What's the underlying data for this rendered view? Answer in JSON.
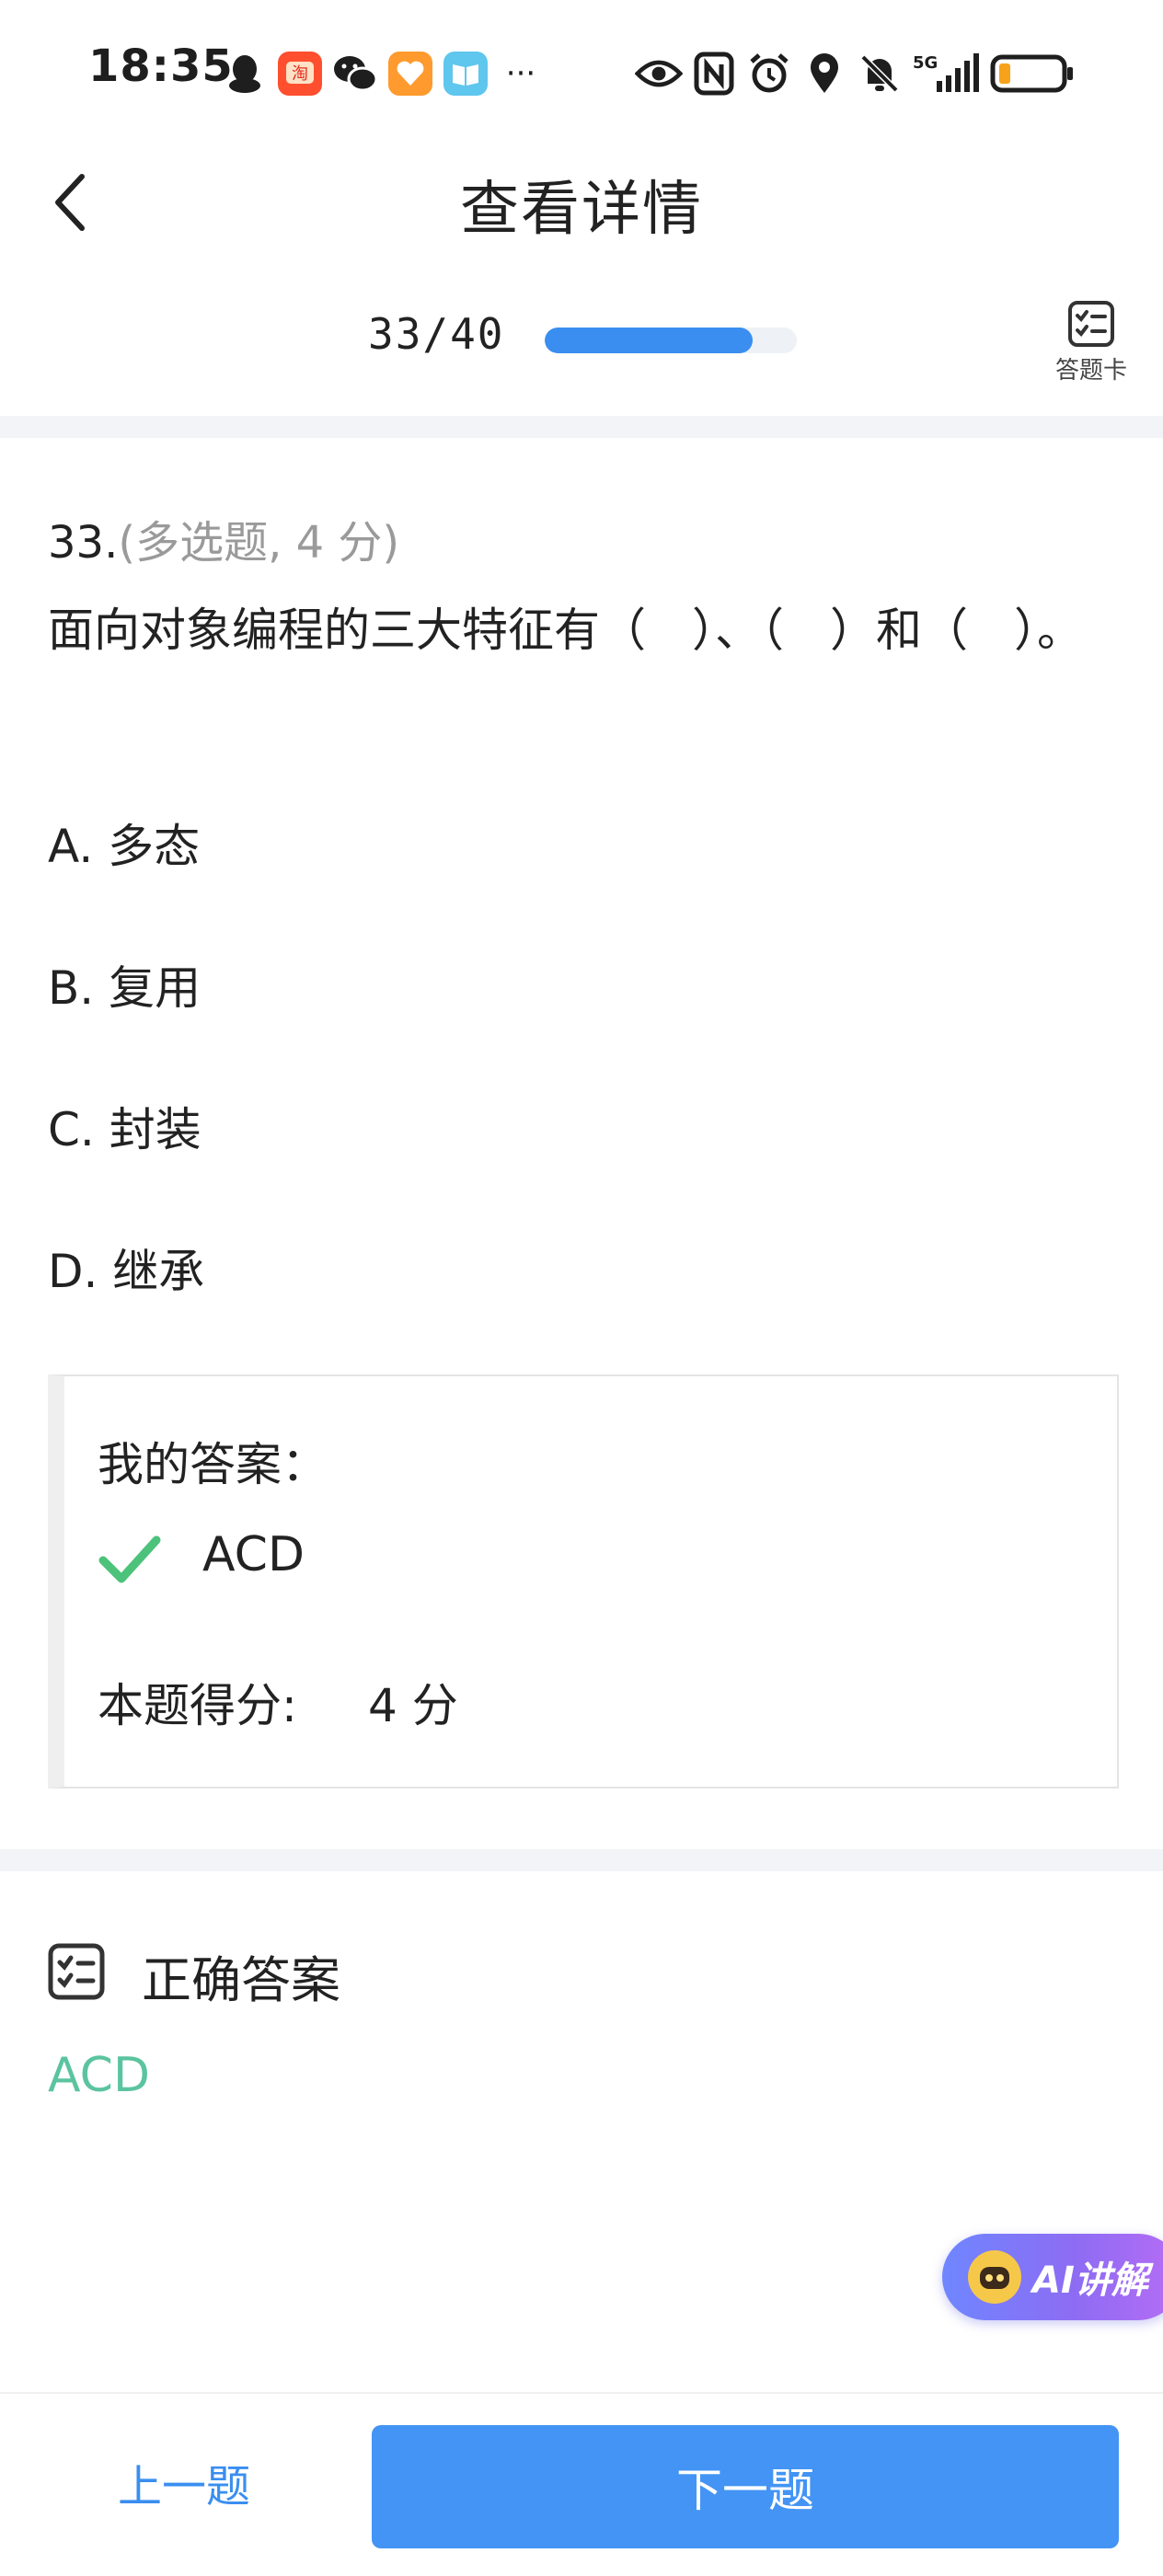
{
  "status_bar": {
    "time": "18:35",
    "left_icons": [
      "qq-icon",
      "taobao-icon",
      "wechat-icon",
      "health-app-icon",
      "reader-app-icon",
      "more-dots-icon"
    ],
    "right_icons": [
      "eye-icon",
      "nfc-icon",
      "alarm-icon",
      "location-icon",
      "mute-bell-icon",
      "signal-5g-icon",
      "battery-icon"
    ],
    "network_label": "5G",
    "more_label": "···"
  },
  "header": {
    "title": "查看详情"
  },
  "progress": {
    "counter": "33/40",
    "fraction": 0.825,
    "answer_card_label": "答题卡"
  },
  "question": {
    "number": "33.",
    "meta": "(多选题, 4 分)",
    "text": "面向对象编程的三大特征有（　）、（　）和（　）。",
    "options": [
      {
        "label": "A. 多态"
      },
      {
        "label": "B. 复用"
      },
      {
        "label": "C. 封装"
      },
      {
        "label": "D. 继承"
      }
    ]
  },
  "my_answer": {
    "label": "我的答案：",
    "value": "ACD",
    "score_label": "本题得分:",
    "score_value": "4 分"
  },
  "correct_answer": {
    "label": "正确答案",
    "value": "ACD"
  },
  "ai_button": {
    "label": "AI讲解"
  },
  "footer": {
    "prev_label": "上一题",
    "next_label": "下一题"
  },
  "colors": {
    "accent": "#4394f4",
    "correct": "#5bc49f",
    "check": "#4cc27a",
    "meta_gray": "#9a9a9a"
  }
}
